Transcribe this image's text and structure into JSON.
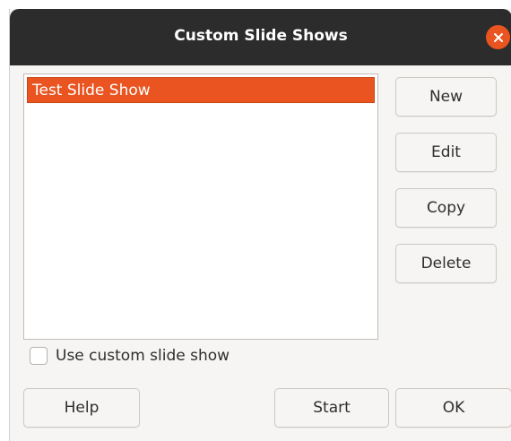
{
  "dialog": {
    "title": "Custom Slide Shows",
    "close_icon": "close-icon"
  },
  "list": {
    "items": [
      {
        "label": "Test Slide Show",
        "selected": true
      }
    ]
  },
  "side_buttons": {
    "new_label": "New",
    "edit_label": "Edit",
    "copy_label": "Copy",
    "delete_label": "Delete"
  },
  "options": {
    "use_custom_label": "Use custom slide show",
    "use_custom_checked": false
  },
  "footer": {
    "help_label": "Help",
    "start_label": "Start",
    "ok_label": "OK"
  },
  "colors": {
    "accent": "#e95420",
    "titlebar": "#2c2c2c",
    "background": "#f6f5f4"
  }
}
